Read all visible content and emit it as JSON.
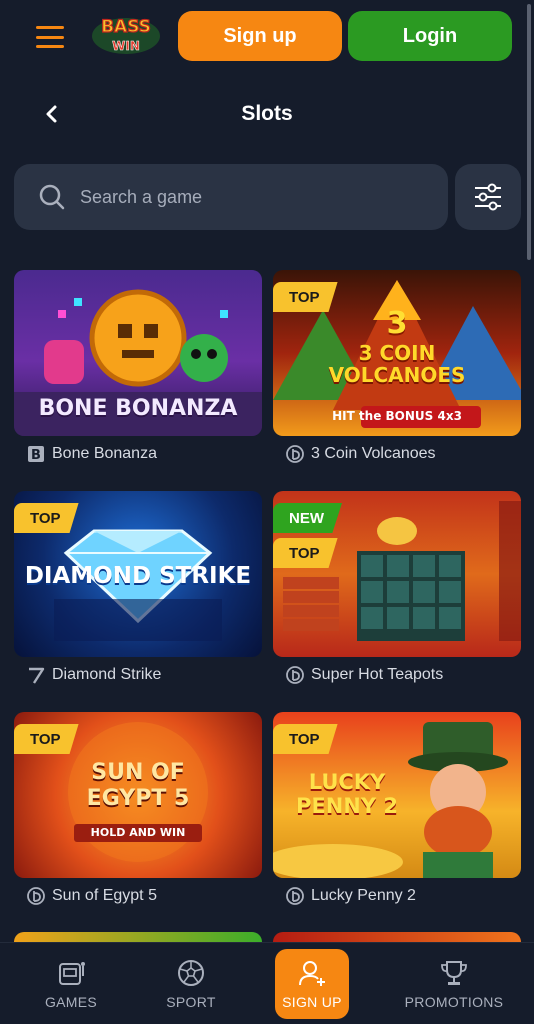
{
  "header": {
    "logo_text": "BASS WIN",
    "signup_label": "Sign up",
    "login_label": "Login"
  },
  "page": {
    "title": "Slots"
  },
  "search": {
    "placeholder": "Search a game"
  },
  "games": [
    {
      "name": "Bone Bonanza",
      "art_title": "BONE BONANZA",
      "badges": [],
      "provider_icon": "b-square-icon"
    },
    {
      "name": "3 Coin Volcanoes",
      "art_title": "3 COIN VOLCANOES",
      "art_sub": "HIT the BONUS 4x3",
      "badges": [
        "TOP"
      ],
      "provider_icon": "d-circle-icon"
    },
    {
      "name": "Diamond Strike",
      "art_title": "DIAMOND STRIKE",
      "badges": [
        "TOP"
      ],
      "provider_icon": "seven-icon"
    },
    {
      "name": "Super Hot Teapots",
      "badges": [
        "NEW",
        "TOP"
      ],
      "provider_icon": "d-circle-icon"
    },
    {
      "name": "Sun of Egypt 5",
      "art_title": "SUN OF EGYPT 5",
      "art_sub": "HOLD AND WIN",
      "badges": [
        "TOP"
      ],
      "provider_icon": "d-circle-icon"
    },
    {
      "name": "Lucky Penny 2",
      "art_title": "LUCKY PENNY 2",
      "badges": [
        "TOP"
      ],
      "provider_icon": "d-circle-icon"
    }
  ],
  "bottom_nav": [
    {
      "label": "GAMES",
      "icon": "slot-machine-icon"
    },
    {
      "label": "SPORT",
      "icon": "soccer-ball-icon"
    },
    {
      "label": "SIGN UP",
      "icon": "add-user-icon",
      "active": true
    },
    {
      "label": "PROMOTIONS",
      "icon": "trophy-icon"
    }
  ],
  "colors": {
    "background": "#151c2b",
    "accent_orange": "#f68712",
    "login_green": "#2b9a22",
    "badge_top": "#f8c22d",
    "badge_new": "#2fa41f"
  }
}
